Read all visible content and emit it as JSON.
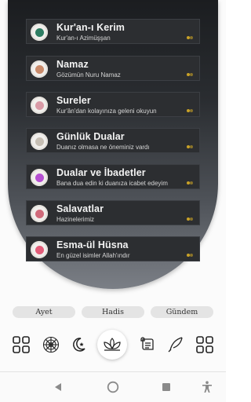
{
  "menu": [
    {
      "title": "Kur'an-ı Kerim",
      "subtitle": "Kur'an-ı Azimüşşan",
      "icon": "quran-icon",
      "color": "#2e7d62"
    },
    {
      "title": "Namaz",
      "subtitle": "Gözümün Nuru Namaz",
      "icon": "prayer-icon",
      "color": "#c98a6a"
    },
    {
      "title": "Sureler",
      "subtitle": "Kur'ân'dan kolayınıza geleni okuyun",
      "icon": "surah-icon",
      "color": "#d99aa6"
    },
    {
      "title": "Günlük Dualar",
      "subtitle": "Duanız olmasa ne öneminiz vardı",
      "icon": "daily-prayer-icon",
      "color": "#c7bfb4"
    },
    {
      "title": "Dualar ve İbadetler",
      "subtitle": "Bana dua edin ki duanıza icabet edeyim",
      "icon": "worship-icon",
      "color": "#b64fd1"
    },
    {
      "title": "Salavatlar",
      "subtitle": "Hazinelerimiz",
      "icon": "salawat-icon",
      "color": "#d06a7a"
    },
    {
      "title": "Esma-ül Hüsna",
      "subtitle": "En güzel isimler Allah'ındır",
      "icon": "asmaul-husna-icon",
      "color": "#e25c78"
    }
  ],
  "tabs": [
    "Ayet",
    "Hadis",
    "Gündem"
  ],
  "iconbar": [
    "grid-icon",
    "mandala-icon",
    "moon-star-icon",
    "lotus-icon",
    "scroll-icon",
    "quill-icon",
    "grid-icon"
  ],
  "accent": "#c9a227"
}
